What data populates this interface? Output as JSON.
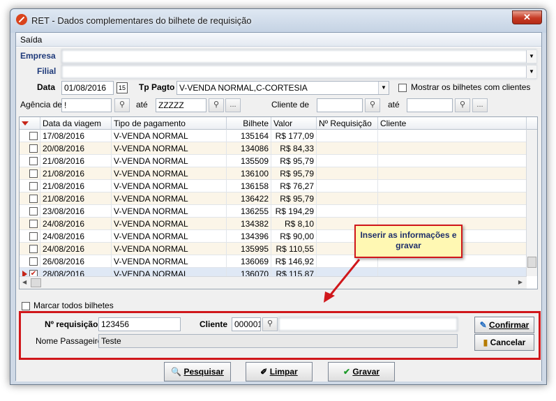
{
  "window": {
    "title": "RET - Dados complementares do bilhete de requisição",
    "close": "✕"
  },
  "menu": {
    "item1": "Saída"
  },
  "filters": {
    "empresa_label": "Empresa",
    "empresa_value": "",
    "filial_label": "Filial",
    "filial_value": "",
    "data_label": "Data",
    "data_value": "01/08/2016",
    "tp_pagto_label": "Tp Pagto",
    "tp_pagto_value": "V-VENDA NORMAL,C-CORTESIA",
    "mostrar_label": "Mostrar os bilhetes com clientes",
    "agencia_label": "Agência de",
    "agencia_from": "!",
    "agencia_ate_label": "até",
    "agencia_to": "ZZZZZ",
    "cliente_label": "Cliente de",
    "cliente_from": "",
    "cliente_ate_label": "até",
    "cliente_to": "",
    "ellipsis": "..."
  },
  "grid": {
    "columns": [
      "Data da viagem",
      "Tipo de pagamento",
      "Bilhete",
      "Valor",
      "Nº Requisição",
      "Cliente"
    ],
    "rows": [
      {
        "date": "17/08/2016",
        "tipo": "V-VENDA NORMAL",
        "bilhete": "135164",
        "valor": "R$ 177,09"
      },
      {
        "date": "20/08/2016",
        "tipo": "V-VENDA NORMAL",
        "bilhete": "134086",
        "valor": "R$ 84,33"
      },
      {
        "date": "21/08/2016",
        "tipo": "V-VENDA NORMAL",
        "bilhete": "135509",
        "valor": "R$ 95,79"
      },
      {
        "date": "21/08/2016",
        "tipo": "V-VENDA NORMAL",
        "bilhete": "136100",
        "valor": "R$ 95,79"
      },
      {
        "date": "21/08/2016",
        "tipo": "V-VENDA NORMAL",
        "bilhete": "136158",
        "valor": "R$ 76,27"
      },
      {
        "date": "21/08/2016",
        "tipo": "V-VENDA NORMAL",
        "bilhete": "136422",
        "valor": "R$ 95,79"
      },
      {
        "date": "23/08/2016",
        "tipo": "V-VENDA NORMAL",
        "bilhete": "136255",
        "valor": "R$ 194,29"
      },
      {
        "date": "24/08/2016",
        "tipo": "V-VENDA NORMAL",
        "bilhete": "134382",
        "valor": "R$ 8,10"
      },
      {
        "date": "24/08/2016",
        "tipo": "V-VENDA NORMAL",
        "bilhete": "134396",
        "valor": "R$ 90,00"
      },
      {
        "date": "24/08/2016",
        "tipo": "V-VENDA NORMAL",
        "bilhete": "135995",
        "valor": "R$ 110,55"
      },
      {
        "date": "26/08/2016",
        "tipo": "V-VENDA NORMAL",
        "bilhete": "136069",
        "valor": "R$ 146,92"
      },
      {
        "date": "28/08/2016",
        "tipo": "V-VENDA NORMAL",
        "bilhete": "136070",
        "valor": "R$ 115,87"
      }
    ],
    "marcar_todos": "Marcar todos bilhetes"
  },
  "detail": {
    "requisicao_label": "Nº requisição",
    "requisicao_value": "123456",
    "cliente_label": "Cliente",
    "cliente_code": "000001",
    "cliente_name": "",
    "passageiro_label": "Nome Passageiro",
    "passageiro_value": "Teste",
    "confirmar": "Confirmar",
    "cancelar": "Cancelar"
  },
  "callout": {
    "text": "Inserir as informações e gravar"
  },
  "buttons": {
    "pesquisar": "Pesquisar",
    "limpar": "Limpar",
    "gravar": "Gravar"
  },
  "colors": {
    "accent_red": "#d0171b",
    "row_alt": "#fbf5e8",
    "label_blue": "#1f3a7a"
  }
}
